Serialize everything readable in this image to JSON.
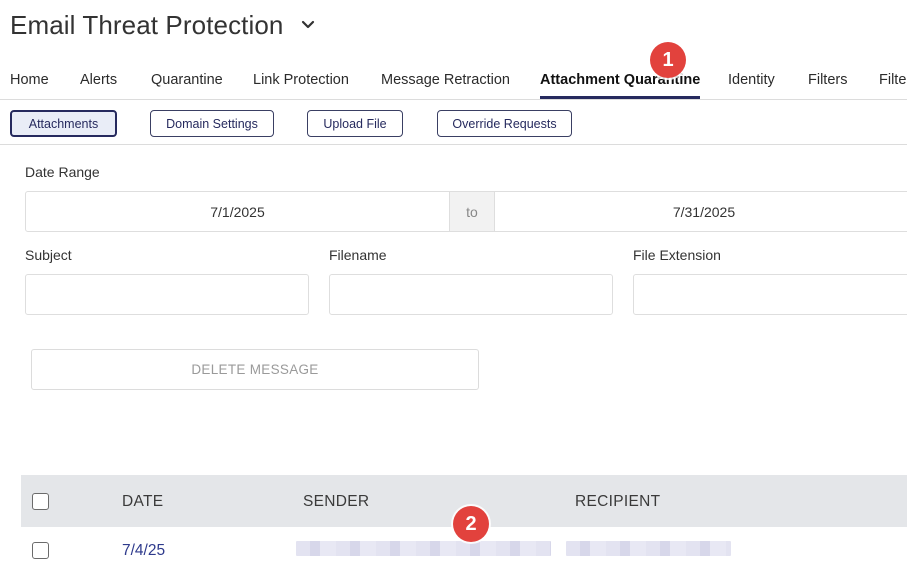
{
  "header": {
    "title": "Email Threat Protection"
  },
  "tabs": [
    {
      "label": "Home"
    },
    {
      "label": "Alerts"
    },
    {
      "label": "Quarantine"
    },
    {
      "label": "Link Protection"
    },
    {
      "label": "Message Retraction"
    },
    {
      "label": "Attachment Quarantine",
      "active": true
    },
    {
      "label": "Identity"
    },
    {
      "label": "Filters"
    },
    {
      "label": "Filter"
    }
  ],
  "subnav": {
    "attachments": "Attachments",
    "domain_settings": "Domain Settings",
    "upload_file": "Upload File",
    "override_requests": "Override Requests"
  },
  "filters": {
    "date_range_label": "Date Range",
    "date_from": "7/1/2025",
    "date_separator": "to",
    "date_to": "7/31/2025",
    "subject_label": "Subject",
    "subject_value": "",
    "filename_label": "Filename",
    "filename_value": "",
    "extension_label": "File Extension",
    "extension_value": ""
  },
  "actions": {
    "delete_label": "DELETE MESSAGE"
  },
  "table": {
    "columns": [
      "DATE",
      "SENDER",
      "RECIPIENT"
    ],
    "rows": [
      {
        "date": "7/4/25",
        "sender": "[redacted]",
        "recipient": "[redacted]"
      }
    ]
  },
  "annotations": {
    "badge1": "1",
    "badge2": "2",
    "color": "#e2423d"
  },
  "colors": {
    "accent": "#262a5e",
    "link": "#2e3a8c",
    "header_bg": "#e4e6e9"
  }
}
